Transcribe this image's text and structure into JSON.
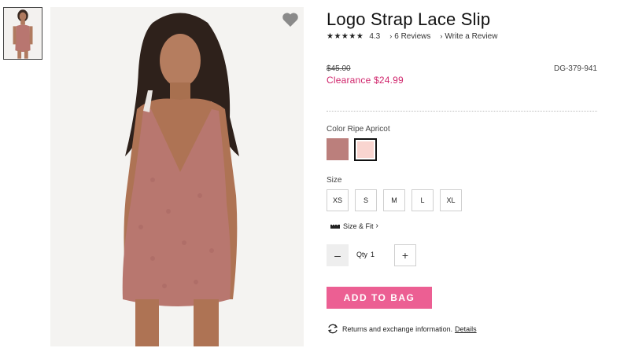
{
  "product": {
    "title": "Logo Strap Lace Slip",
    "stars": "★★★★★",
    "rating": "4.3",
    "reviews_label": "6 Reviews",
    "write_review_label": "Write a Review",
    "chevron": "›",
    "original_price": "$45.00",
    "sale_price": "Clearance $24.99",
    "sku": "DG-379-941"
  },
  "color": {
    "label": "Color Ripe Apricot",
    "swatches": [
      {
        "hex": "#bb7f7c",
        "selected": false
      },
      {
        "hex": "#f9d5d0",
        "selected": true
      }
    ]
  },
  "size": {
    "label": "Size",
    "options": [
      "XS",
      "S",
      "M",
      "L",
      "XL"
    ],
    "fit_label": "Size & Fit",
    "fit_chevron": "›"
  },
  "quantity": {
    "minus": "–",
    "label": "Qty",
    "value": "1",
    "plus": "+"
  },
  "cart": {
    "add_label": "ADD TO BAG"
  },
  "returns": {
    "text": "Returns and exchange information.",
    "link": "Details"
  },
  "icons": {
    "favorite": "heart-icon",
    "ruler": "ruler-icon",
    "returns": "exchange-arrows-icon"
  },
  "colors": {
    "accent_pink": "#ec5f93",
    "sale_pink": "#d0266c"
  }
}
